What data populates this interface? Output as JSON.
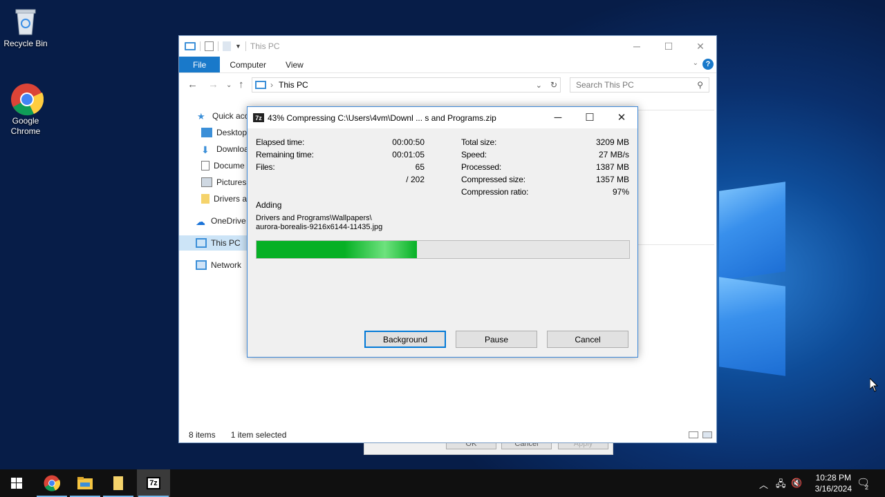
{
  "desktop": {
    "icons": [
      {
        "label": "Recycle Bin"
      },
      {
        "label": "Google Chrome"
      }
    ]
  },
  "explorer": {
    "title": "This PC",
    "ribbon_tabs": [
      "File",
      "Computer",
      "View"
    ],
    "address": "This PC",
    "search_placeholder": "Search This PC",
    "nav_items": [
      "Quick acce",
      "Desktop",
      "Downloa",
      "Docume",
      "Pictures",
      "Drivers a",
      "OneDrive",
      "This PC",
      "Network"
    ],
    "status_items_count": "8 items",
    "status_selected": "1 item selected"
  },
  "back_dialog": {
    "buttons": [
      "OK",
      "Cancel",
      "Apply"
    ]
  },
  "zip_dialog": {
    "title": "43% Compressing C:\\Users\\4vm\\Downl ... s and Programs.zip",
    "progress_percent": 43,
    "left_labels": {
      "elapsed": "Elapsed time:",
      "remaining": "Remaining time:",
      "files": "Files:"
    },
    "left_values": {
      "elapsed": "00:00:50",
      "remaining": "00:01:05",
      "files": "65",
      "files_total": "/ 202"
    },
    "right_labels": {
      "total_size": "Total size:",
      "speed": "Speed:",
      "processed": "Processed:",
      "compressed_size": "Compressed size:",
      "ratio": "Compression ratio:"
    },
    "right_values": {
      "total_size": "3209 MB",
      "speed": "27 MB/s",
      "processed": "1387 MB",
      "compressed_size": "1357 MB",
      "ratio": "97%"
    },
    "action": "Adding",
    "current_file_line1": "Drivers and Programs\\Wallpapers\\",
    "current_file_line2": "aurora-borealis-9216x6144-11435.jpg",
    "buttons": {
      "background": "Background",
      "pause": "Pause",
      "cancel": "Cancel"
    }
  },
  "taskbar": {
    "time": "10:28 PM",
    "date": "3/16/2024",
    "notification_count": "2",
    "apps": [
      "start-icon",
      "chrome-icon",
      "file-explorer-icon",
      "folder-icon",
      "7zip-icon"
    ]
  },
  "colors": {
    "accent": "#1979ca",
    "progress": "#06b025",
    "dialog_border": "#3d87d6"
  }
}
